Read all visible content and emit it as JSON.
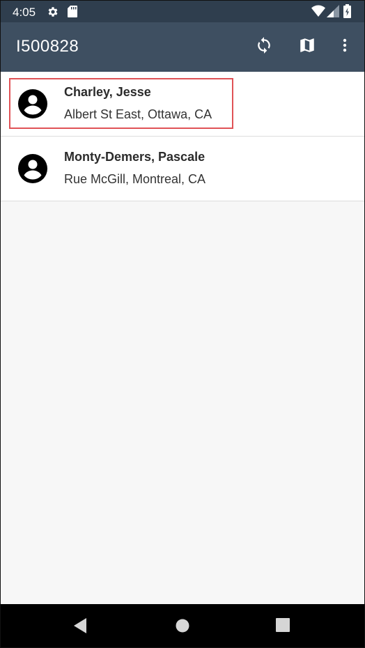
{
  "status_bar": {
    "time": "4:05",
    "left_icons": [
      "gear-icon",
      "sd-card-icon"
    ],
    "right_icons": [
      "wifi-icon",
      "signal-icon",
      "battery-icon"
    ]
  },
  "app_bar": {
    "title": "I500828",
    "actions": [
      "sync-icon",
      "map-icon",
      "more-vert-icon"
    ],
    "background": "#3e4f61"
  },
  "contacts": [
    {
      "name": "Charley, Jesse",
      "address": "Albert St East, Ottawa, CA",
      "icon": "account-circle-icon",
      "highlighted": true
    },
    {
      "name": "Monty-Demers, Pascale",
      "address": "Rue McGill, Montreal, CA",
      "icon": "account-circle-icon",
      "highlighted": false
    }
  ],
  "nav_bar": {
    "buttons": [
      "back-icon",
      "home-icon",
      "recents-icon"
    ]
  },
  "colors": {
    "status_bar": "#2f3e4e",
    "highlight_border": "#e05256",
    "list_background": "#f7f7f7"
  }
}
